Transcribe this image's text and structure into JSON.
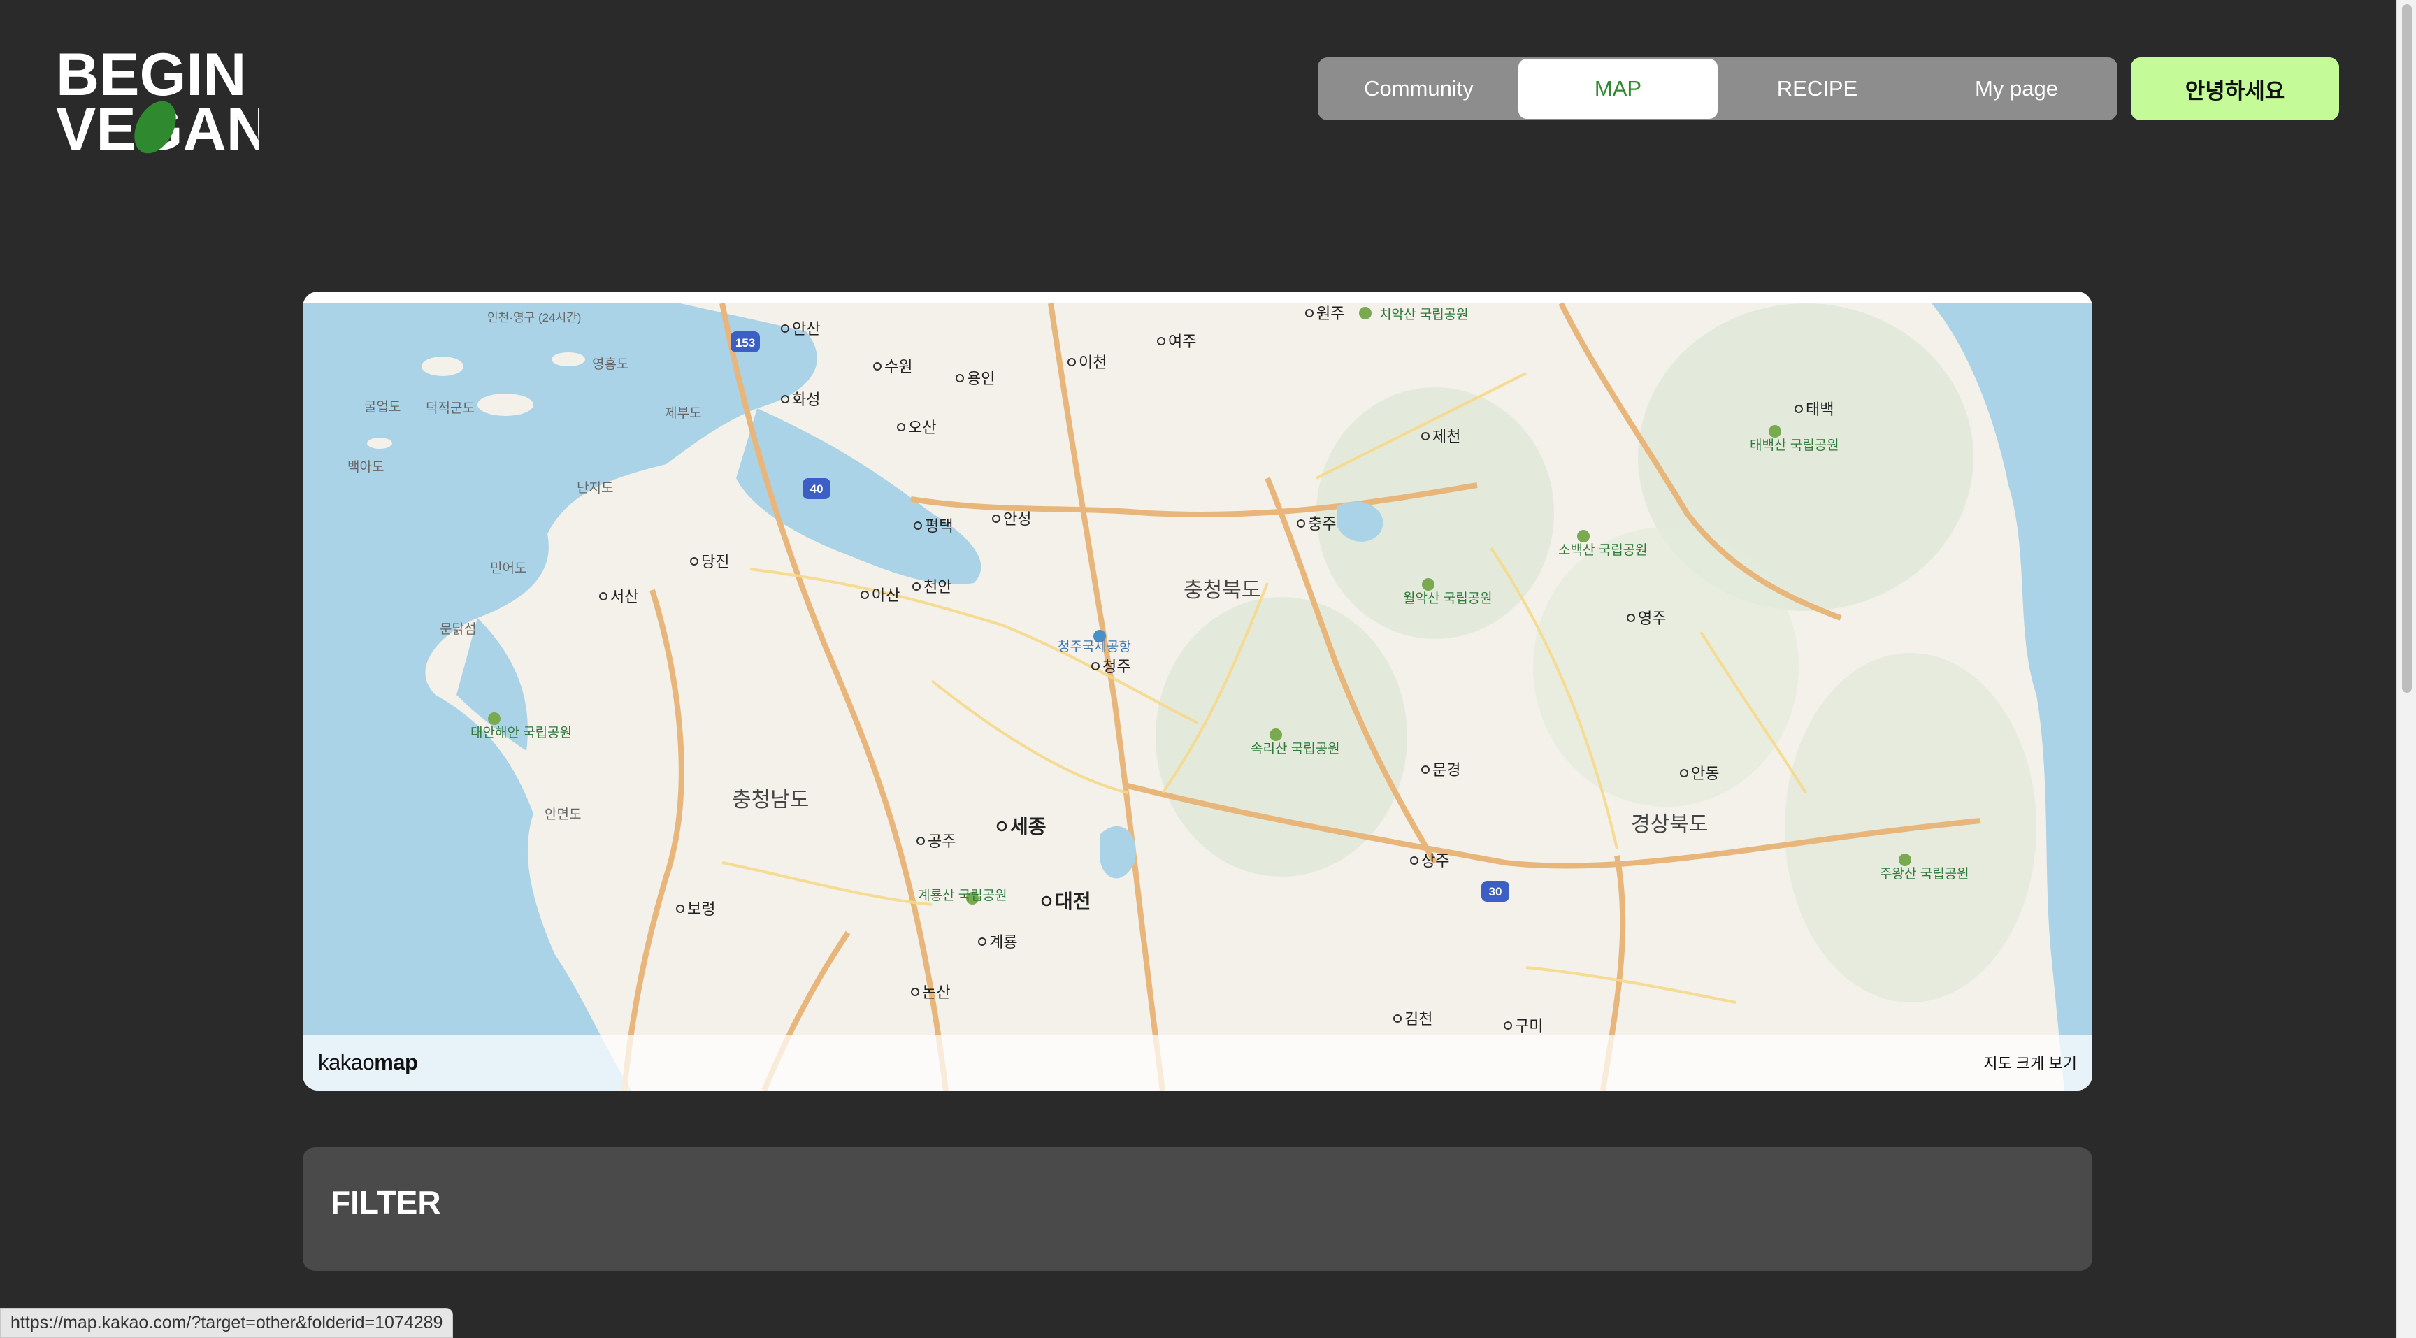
{
  "header": {
    "logo_text_line1": "BEGIN",
    "logo_text_line2": "VEGAN",
    "nav": [
      {
        "label": "Community",
        "active": false
      },
      {
        "label": "MAP",
        "active": true
      },
      {
        "label": "RECIPE",
        "active": false
      },
      {
        "label": "My page",
        "active": false
      }
    ],
    "greeting_button": "안녕하세요",
    "colors": {
      "accent_green": "#c4fa97",
      "active_tab_text": "#2f8a2f"
    }
  },
  "map": {
    "provider_logo_light": "kakao",
    "provider_logo_bold": "map",
    "expand_label": "지도 크게 보기",
    "regions": [
      "충청북도",
      "충청남도",
      "경상북도"
    ],
    "cities": [
      "안산",
      "수원",
      "용인",
      "이천",
      "여주",
      "원주",
      "화성",
      "오산",
      "평택",
      "안성",
      "제천",
      "충주",
      "당진",
      "천안",
      "아산",
      "서산",
      "청주",
      "세종",
      "공주",
      "대전",
      "계룡",
      "논산",
      "보령",
      "문경",
      "상주",
      "영주",
      "안동",
      "태백",
      "김천",
      "구미"
    ],
    "places": [
      "청주국제공항",
      "태안해안 국립공원",
      "속리산 국립공원",
      "월악산 국립공원",
      "소백산 국립공원",
      "태백산 국립공원",
      "주왕산 국립공원",
      "계룡산 국립공원",
      "치악산 국립공원"
    ],
    "islands": [
      "영흥도",
      "덕적군도",
      "굴업도",
      "제부도",
      "백아도",
      "난지도",
      "민어도",
      "문닭섬",
      "안면도",
      "인천·영구 (24시간)"
    ],
    "highways": [
      "153",
      "40",
      "30"
    ]
  },
  "filter": {
    "title": "FILTER"
  },
  "status_bar": {
    "url": "https://map.kakao.com/?target=other&folderid=1074289"
  }
}
